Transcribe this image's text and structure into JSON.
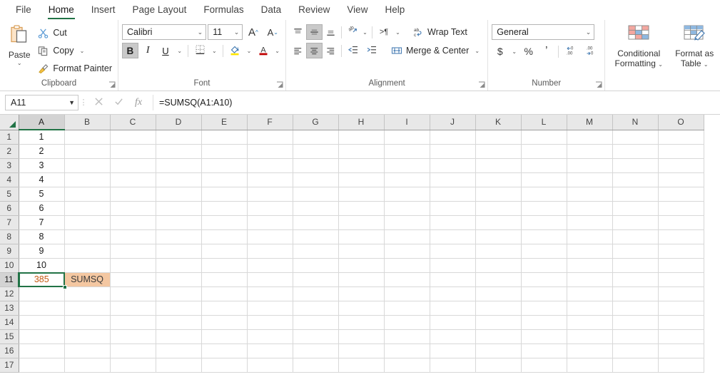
{
  "app": {
    "accent_green": "#217346",
    "orange_text": "#C55A11",
    "peach_fill": "#F4C7A1"
  },
  "tabs": [
    {
      "label": "File",
      "active": false
    },
    {
      "label": "Home",
      "active": true
    },
    {
      "label": "Insert",
      "active": false
    },
    {
      "label": "Page Layout",
      "active": false
    },
    {
      "label": "Formulas",
      "active": false
    },
    {
      "label": "Data",
      "active": false
    },
    {
      "label": "Review",
      "active": false
    },
    {
      "label": "View",
      "active": false
    },
    {
      "label": "Help",
      "active": false
    }
  ],
  "ribbon": {
    "clipboard": {
      "group_label": "Clipboard",
      "paste_label": "Paste",
      "commands": [
        {
          "label": "Cut",
          "icon": "scissors-icon"
        },
        {
          "label": "Copy",
          "icon": "copy-icon"
        },
        {
          "label": "Format Painter",
          "icon": "format-painter-icon"
        }
      ]
    },
    "font": {
      "group_label": "Font",
      "font_name": "Calibri",
      "font_size": "11",
      "bold_label": "B",
      "italic_label": "I",
      "underline_label": "U",
      "grow_font_label": "A",
      "shrink_font_label": "A",
      "borders_icon": "borders-icon",
      "fill_color_icon": "fill-color-icon",
      "font_color_icon": "font-color-icon"
    },
    "alignment": {
      "group_label": "Alignment",
      "wrap_text_label": "Wrap Text",
      "merge_center_label": "Merge & Center",
      "orientation_icon": "orientation-icon",
      "ltr_icon": "text-direction-icon",
      "decrease_indent_icon": "decrease-indent-icon",
      "increase_indent_icon": "increase-indent-icon"
    },
    "number": {
      "group_label": "Number",
      "format": "General",
      "currency_label": "$",
      "percent_label": "%",
      "comma_label": "͵",
      "increase_decimal_icon": "increase-decimal-icon",
      "decrease_decimal_icon": "decrease-decimal-icon"
    },
    "styles": {
      "conditional_formatting_label": "Conditional\nFormatting",
      "conditional_formatting_line1": "Conditional",
      "conditional_formatting_line2": "Formatting",
      "format_as_table_line1": "Format as",
      "format_as_table_line2": "Table"
    }
  },
  "formula_bar": {
    "name_box": "A11",
    "cancel_icon": "cancel-icon",
    "enter_icon": "enter-icon",
    "fx_icon": "insert-function-icon",
    "formula": "=SUMSQ(A1:A10)"
  },
  "sheet": {
    "columns": [
      "A",
      "B",
      "C",
      "D",
      "E",
      "F",
      "G",
      "H",
      "I",
      "J",
      "K",
      "L",
      "M",
      "N",
      "O"
    ],
    "selected_column": "A",
    "selected_row": 11,
    "rows": [
      {
        "num": 1,
        "cells": {
          "A": "1"
        }
      },
      {
        "num": 2,
        "cells": {
          "A": "2"
        }
      },
      {
        "num": 3,
        "cells": {
          "A": "3"
        }
      },
      {
        "num": 4,
        "cells": {
          "A": "4"
        }
      },
      {
        "num": 5,
        "cells": {
          "A": "5"
        }
      },
      {
        "num": 6,
        "cells": {
          "A": "6"
        }
      },
      {
        "num": 7,
        "cells": {
          "A": "7"
        }
      },
      {
        "num": 8,
        "cells": {
          "A": "8"
        }
      },
      {
        "num": 9,
        "cells": {
          "A": "9"
        }
      },
      {
        "num": 10,
        "cells": {
          "A": "10"
        }
      },
      {
        "num": 11,
        "cells": {
          "A": "385",
          "B": "SUMSQ"
        }
      },
      {
        "num": 12,
        "cells": {}
      },
      {
        "num": 13,
        "cells": {}
      },
      {
        "num": 14,
        "cells": {}
      },
      {
        "num": 15,
        "cells": {}
      },
      {
        "num": 16,
        "cells": {}
      },
      {
        "num": 17,
        "cells": {}
      }
    ],
    "cell_styles": {
      "A11": "orange-text",
      "B11": "fill-peach"
    }
  }
}
